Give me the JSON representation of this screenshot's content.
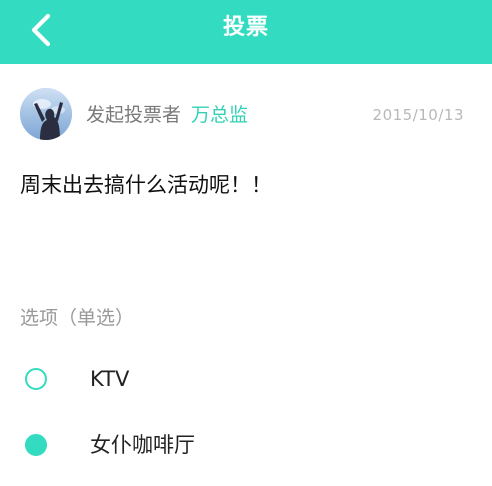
{
  "header": {
    "title": "投票",
    "back_icon": "chevron-left-icon",
    "background_color": "#33dcc0"
  },
  "poll": {
    "initiator_label": "发起投票者",
    "initiator_name": "万总监",
    "date": "2015/10/13",
    "question": "周末出去搞什么活动呢！！",
    "options_header": "选项（单选）",
    "options": [
      {
        "label": "KTV",
        "selected": false
      },
      {
        "label": "女仆咖啡厅",
        "selected": true
      }
    ]
  },
  "colors": {
    "accent": "#33dcc0",
    "name_color": "#33d1b6",
    "muted_text": "#999999",
    "date_text": "#b8b8b8"
  }
}
